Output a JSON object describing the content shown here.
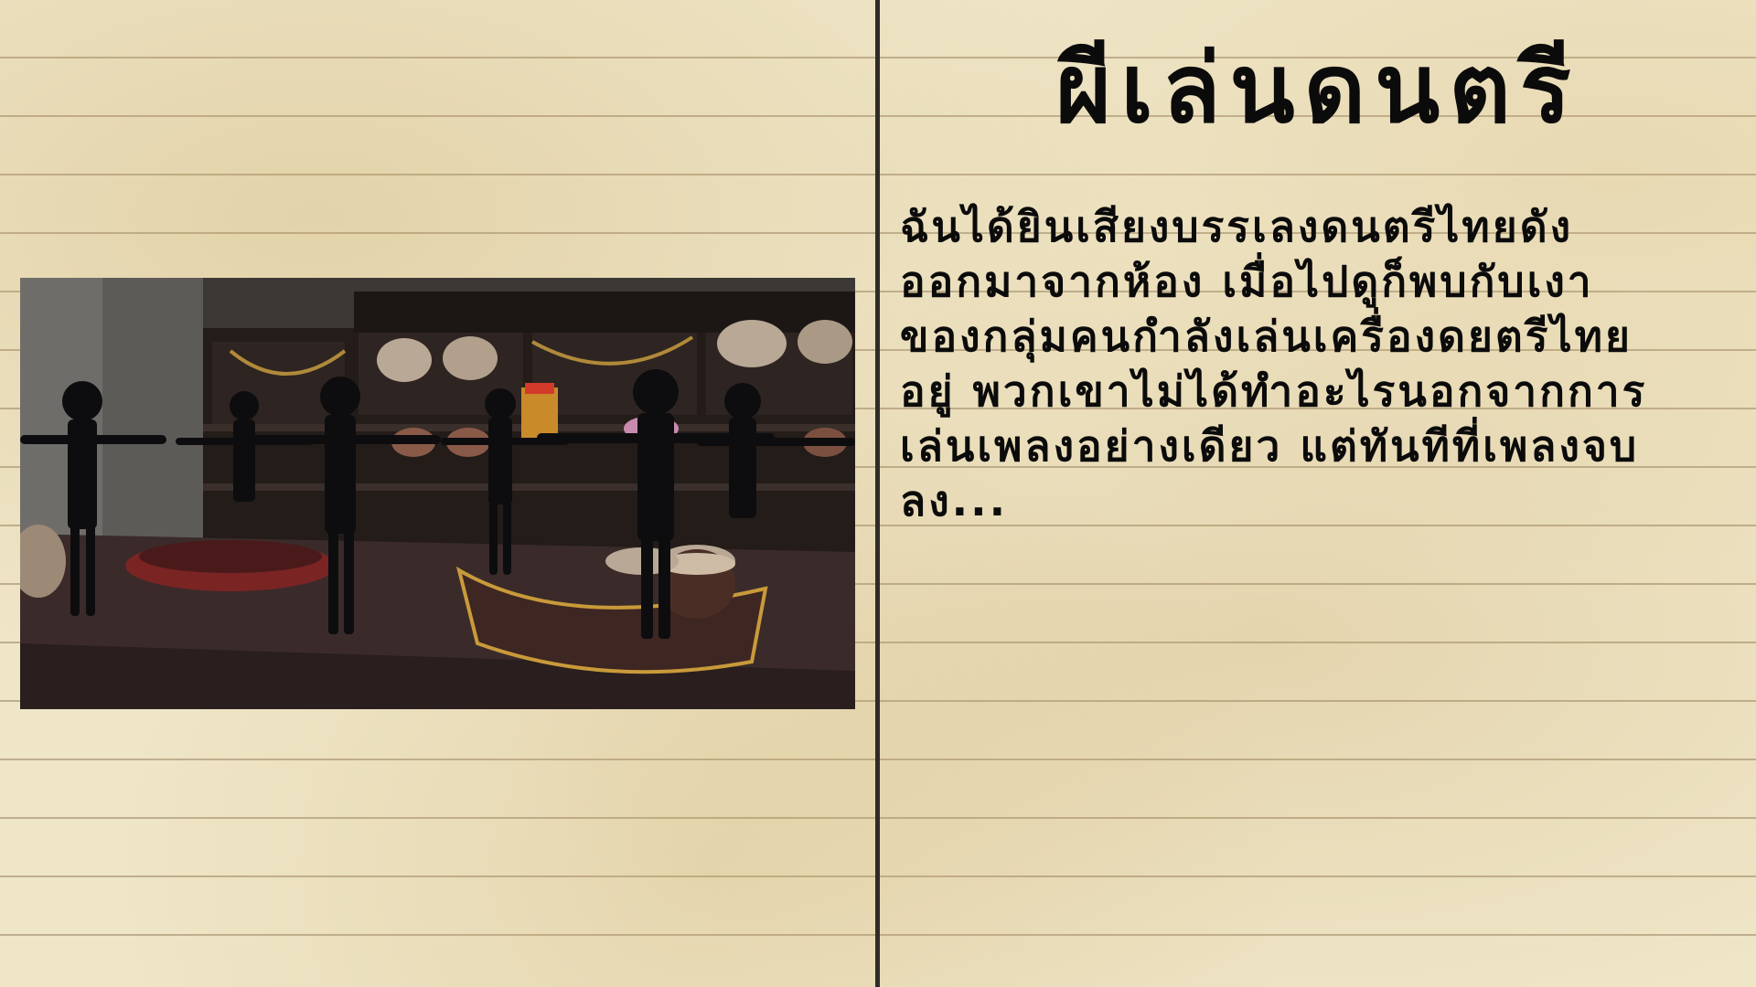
{
  "page": {
    "title": "ผีเล่นดนตรี",
    "story_lines": [
      "ฉันได้ยินเสียงบรรเลงดนตรีไทยดัง",
      "ออกมาจากห้อง เมื่อไปดูก็พบกับเงา",
      "ของกลุ่มคนกำลังเล่นเครื่องดยตรีไทย",
      "อยู่ พวกเขาไม่ได้ทำอะไรนอกจากการ",
      "เล่นเพลงอย่างเดียว แต่ทันทีที่เพลงจบ",
      "ลง..."
    ]
  },
  "colors": {
    "paper": "#efe6c8",
    "rule_lines": "#968260",
    "divider": "#2f2c28",
    "text": "#0b0b0b"
  }
}
